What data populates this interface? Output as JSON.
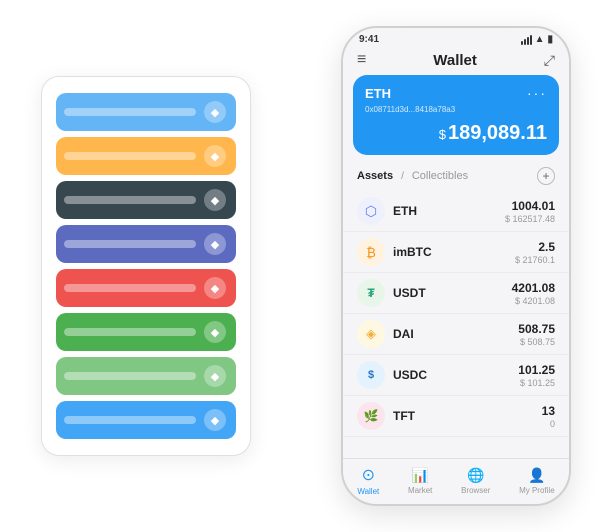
{
  "scene": {
    "card_stack": {
      "cards": [
        {
          "color": "#64B5F6",
          "icon": "◆"
        },
        {
          "color": "#FFB74D",
          "icon": "◆"
        },
        {
          "color": "#37474F",
          "icon": "◆"
        },
        {
          "color": "#5C6BC0",
          "icon": "◆"
        },
        {
          "color": "#EF5350",
          "icon": "◆"
        },
        {
          "color": "#4CAF50",
          "icon": "◆"
        },
        {
          "color": "#81C784",
          "icon": "◆"
        },
        {
          "color": "#42A5F5",
          "icon": "◆"
        }
      ]
    },
    "phone": {
      "status_bar": {
        "time": "9:41",
        "signal": "●●●●",
        "wifi": "wifi",
        "battery": "battery"
      },
      "header": {
        "menu_icon": "≡",
        "title": "Wallet",
        "expand_icon": "⤢"
      },
      "eth_card": {
        "symbol": "ETH",
        "address": "0x08711d3d...8418a78a3",
        "address_suffix": "⓪",
        "balance_label": "$",
        "balance": "189,089.11"
      },
      "assets_header": {
        "active_tab": "Assets",
        "divider": "/",
        "inactive_tab": "Collectibles",
        "add_icon": "+"
      },
      "assets": [
        {
          "name": "ETH",
          "logo_color": "#627EEA",
          "logo_text": "⬡",
          "amount": "1004.01",
          "usd": "$ 162517.48"
        },
        {
          "name": "imBTC",
          "logo_color": "#F7931A",
          "logo_text": "₿",
          "amount": "2.5",
          "usd": "$ 21760.1"
        },
        {
          "name": "USDT",
          "logo_color": "#26A17B",
          "logo_text": "₮",
          "amount": "4201.08",
          "usd": "$ 4201.08"
        },
        {
          "name": "DAI",
          "logo_color": "#F5AC37",
          "logo_text": "◈",
          "amount": "508.75",
          "usd": "$ 508.75"
        },
        {
          "name": "USDC",
          "logo_color": "#2775CA",
          "logo_text": "$",
          "amount": "101.25",
          "usd": "$ 101.25"
        },
        {
          "name": "TFT",
          "logo_color": "#E91E8C",
          "logo_text": "🌿",
          "amount": "13",
          "usd": "0"
        }
      ],
      "bottom_nav": [
        {
          "label": "Wallet",
          "active": true,
          "icon": "⊙"
        },
        {
          "label": "Market",
          "active": false,
          "icon": "📈"
        },
        {
          "label": "Browser",
          "active": false,
          "icon": "👤"
        },
        {
          "label": "My Profile",
          "active": false,
          "icon": "👤"
        }
      ]
    }
  }
}
